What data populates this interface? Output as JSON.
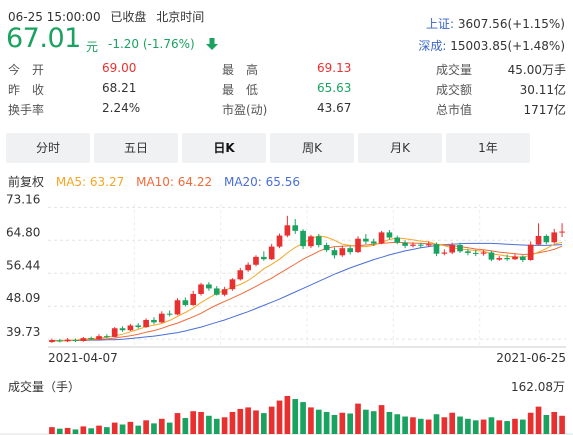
{
  "header": {
    "datetime": "06-25 15:00:00",
    "status": "已收盘",
    "timezone": "北京时间",
    "price": "67.01",
    "unit": "元",
    "change": "-1.20 (-1.76%)",
    "direction_icon": "arrow-down-icon",
    "down_color": "#1aa260",
    "up_color": "#e93030"
  },
  "indices": [
    {
      "label": "上证:",
      "value": "3607.56(+1.15%)"
    },
    {
      "label": "深成:",
      "value": "15003.85(+1.48%)"
    }
  ],
  "stats": {
    "open_label": "今　开",
    "open_value": "69.00",
    "high_label": "最　高",
    "high_value": "69.13",
    "volume_label": "成交量",
    "volume_value": "45.00万手",
    "prev_label": "昨　收",
    "prev_value": "68.21",
    "low_label": "最　低",
    "low_value": "65.63",
    "amount_label": "成交额",
    "amount_value": "30.11亿",
    "turnover_label": "换手率",
    "turnover_value": "2.24%",
    "pe_label": "市盈(动)",
    "pe_value": "43.67",
    "mktcap_label": "总市值",
    "mktcap_value": "1717亿"
  },
  "tabs": [
    {
      "label": "分时",
      "active": false
    },
    {
      "label": "五日",
      "active": false
    },
    {
      "label": "日K",
      "active": true
    },
    {
      "label": "周K",
      "active": false
    },
    {
      "label": "月K",
      "active": false
    },
    {
      "label": "1年",
      "active": false
    }
  ],
  "legend": {
    "adjust": "前复权",
    "ma5": "MA5: 63.27",
    "ma10": "MA10: 64.22",
    "ma20": "MA20: 65.56",
    "ma5_color": "#f5a623",
    "ma10_color": "#f06a3a",
    "ma20_color": "#4a6fd6"
  },
  "volume_label": "成交量（手）",
  "volume_max_label": "162.08万",
  "chart_data": [
    {
      "type": "candlestick",
      "y_tick_labels": [
        "73.16",
        "64.80",
        "56.44",
        "48.09",
        "39.73"
      ],
      "y_ticks": [
        73.16,
        64.8,
        56.44,
        48.09,
        39.73
      ],
      "ylim": [
        38.0,
        74.0
      ],
      "x_tick_labels": [
        "2021-04-07",
        "2021-06-25"
      ],
      "grid": true,
      "candles": [
        [
          39.0,
          39.5,
          39.9,
          38.8
        ],
        [
          39.4,
          39.2,
          39.8,
          38.9
        ],
        [
          39.2,
          39.6,
          40.0,
          39.0
        ],
        [
          39.5,
          39.3,
          39.9,
          39.0
        ],
        [
          39.3,
          40.0,
          40.3,
          39.1
        ],
        [
          40.0,
          39.7,
          40.4,
          39.4
        ],
        [
          39.7,
          40.5,
          41.0,
          39.6
        ],
        [
          40.5,
          40.3,
          41.0,
          40.0
        ],
        [
          40.3,
          42.5,
          42.8,
          40.2
        ],
        [
          42.5,
          42.0,
          43.0,
          41.6
        ],
        [
          42.0,
          43.2,
          43.6,
          41.8
        ],
        [
          43.2,
          42.8,
          43.8,
          42.4
        ],
        [
          42.8,
          44.6,
          45.0,
          42.6
        ],
        [
          44.6,
          44.0,
          45.3,
          43.5
        ],
        [
          44.0,
          46.2,
          46.8,
          43.8
        ],
        [
          46.2,
          46.0,
          47.0,
          45.5
        ],
        [
          46.0,
          49.6,
          50.1,
          45.8
        ],
        [
          49.6,
          48.4,
          50.3,
          48.0
        ],
        [
          48.4,
          51.2,
          52.0,
          48.2
        ],
        [
          51.2,
          53.6,
          54.0,
          50.8
        ],
        [
          53.6,
          52.6,
          54.2,
          52.0
        ],
        [
          52.6,
          51.0,
          53.2,
          50.8
        ],
        [
          51.0,
          52.4,
          53.0,
          50.6
        ],
        [
          52.4,
          54.9,
          55.2,
          52.0
        ],
        [
          54.9,
          57.2,
          57.8,
          54.6
        ],
        [
          57.2,
          58.6,
          59.2,
          56.8
        ],
        [
          58.6,
          60.6,
          61.0,
          58.2
        ],
        [
          60.6,
          60.0,
          62.0,
          59.6
        ],
        [
          60.0,
          63.2,
          63.9,
          59.8
        ],
        [
          63.2,
          66.0,
          66.5,
          62.8
        ],
        [
          66.0,
          68.6,
          71.0,
          65.6
        ],
        [
          68.6,
          67.2,
          70.2,
          66.4
        ],
        [
          67.2,
          63.3,
          67.6,
          62.6
        ],
        [
          63.3,
          65.8,
          66.2,
          62.8
        ],
        [
          65.8,
          63.6,
          66.4,
          63.0
        ],
        [
          63.6,
          62.3,
          64.2,
          61.8
        ],
        [
          62.3,
          61.0,
          63.0,
          60.2
        ],
        [
          61.0,
          62.8,
          63.4,
          60.6
        ],
        [
          62.8,
          61.8,
          63.4,
          61.2
        ],
        [
          61.8,
          65.2,
          65.8,
          61.6
        ],
        [
          65.2,
          64.5,
          66.4,
          63.8
        ],
        [
          64.5,
          64.0,
          65.2,
          63.4
        ],
        [
          64.0,
          66.8,
          67.2,
          63.8
        ],
        [
          66.8,
          65.5,
          67.4,
          65.0
        ],
        [
          65.5,
          64.2,
          66.0,
          63.8
        ],
        [
          64.2,
          63.4,
          64.8,
          62.8
        ],
        [
          63.4,
          63.7,
          64.3,
          63.0
        ],
        [
          63.7,
          63.5,
          64.2,
          62.9
        ],
        [
          63.5,
          63.8,
          64.5,
          63.1
        ],
        [
          63.8,
          61.4,
          64.2,
          60.8
        ],
        [
          61.4,
          61.7,
          62.5,
          61.0
        ],
        [
          61.7,
          63.6,
          64.2,
          61.3
        ],
        [
          63.6,
          62.0,
          64.2,
          61.6
        ],
        [
          62.0,
          61.6,
          62.6,
          61.0
        ],
        [
          61.6,
          61.4,
          62.4,
          60.8
        ],
        [
          61.4,
          61.7,
          62.3,
          60.9
        ],
        [
          61.7,
          59.9,
          62.2,
          59.5
        ],
        [
          59.9,
          60.3,
          60.8,
          59.6
        ],
        [
          60.3,
          60.0,
          61.2,
          59.6
        ],
        [
          60.0,
          60.7,
          61.4,
          59.8
        ],
        [
          60.7,
          59.8,
          61.0,
          59.3
        ],
        [
          59.8,
          63.7,
          64.5,
          59.6
        ],
        [
          63.7,
          65.9,
          69.1,
          63.5
        ],
        [
          65.9,
          64.3,
          66.3,
          63.8
        ],
        [
          64.3,
          66.8,
          67.7,
          64.0
        ],
        [
          66.8,
          67.01,
          69.13,
          65.63
        ]
      ],
      "ma5": [
        39.2,
        39.4,
        39.5,
        39.5,
        39.7,
        39.9,
        40.0,
        40.2,
        40.6,
        41.0,
        41.6,
        42.2,
        42.9,
        43.3,
        43.7,
        44.5,
        45.5,
        46.5,
        47.6,
        49.0,
        50.2,
        51.3,
        52.1,
        52.9,
        53.6,
        54.6,
        56.0,
        57.6,
        58.7,
        60.0,
        61.6,
        63.0,
        64.1,
        65.2,
        65.9,
        65.6,
        64.8,
        63.8,
        63.5,
        63.2,
        63.2,
        63.5,
        64.3,
        65.0,
        65.4,
        65.2,
        64.9,
        64.6,
        64.4,
        63.8,
        63.4,
        62.9,
        62.6,
        62.4,
        62.2,
        62.0,
        61.4,
        61.1,
        60.8,
        60.6,
        60.5,
        61.0,
        61.8,
        62.7,
        63.8,
        64.3
      ],
      "ma10": [
        39.3,
        39.3,
        39.4,
        39.4,
        39.5,
        39.6,
        39.7,
        39.8,
        40.0,
        40.3,
        40.6,
        41.0,
        41.5,
        41.9,
        42.5,
        43.2,
        43.8,
        44.6,
        45.4,
        46.3,
        47.4,
        48.4,
        49.3,
        50.2,
        51.1,
        52.1,
        53.1,
        54.2,
        55.2,
        56.4,
        57.6,
        58.8,
        60.0,
        61.0,
        62.0,
        62.8,
        63.2,
        63.3,
        63.4,
        63.4,
        63.6,
        63.8,
        64.0,
        64.2,
        64.3,
        64.2,
        64.1,
        64.0,
        63.9,
        63.8,
        63.6,
        63.4,
        63.2,
        62.9,
        62.6,
        62.4,
        62.1,
        61.8,
        61.6,
        61.4,
        61.2,
        61.3,
        61.6,
        62.0,
        62.5,
        63.3
      ],
      "ma20": [
        39.4,
        39.4,
        39.4,
        39.4,
        39.4,
        39.5,
        39.5,
        39.6,
        39.6,
        39.7,
        39.9,
        40.1,
        40.3,
        40.5,
        40.8,
        41.1,
        41.4,
        41.8,
        42.3,
        42.8,
        43.4,
        44.0,
        44.6,
        45.3,
        46.0,
        46.7,
        47.5,
        48.3,
        49.1,
        49.9,
        50.8,
        51.7,
        52.6,
        53.5,
        54.4,
        55.3,
        56.2,
        57.0,
        57.8,
        58.5,
        59.2,
        59.9,
        60.5,
        61.1,
        61.6,
        62.1,
        62.5,
        62.9,
        63.2,
        63.5,
        63.7,
        63.8,
        63.9,
        64.0,
        64.0,
        64.0,
        64.0,
        63.9,
        63.8,
        63.7,
        63.6,
        63.5,
        63.5,
        63.5,
        63.6,
        63.7
      ]
    },
    {
      "type": "bar",
      "title": "成交量（手）",
      "ymax_label": "162.08万",
      "values": [
        18,
        14,
        16,
        12,
        20,
        15,
        22,
        18,
        30,
        25,
        32,
        22,
        36,
        28,
        40,
        30,
        55,
        42,
        60,
        58,
        48,
        40,
        44,
        58,
        66,
        70,
        62,
        55,
        72,
        88,
        100,
        92,
        84,
        70,
        64,
        58,
        50,
        56,
        54,
        80,
        64,
        60,
        76,
        58,
        52,
        46,
        44,
        40,
        38,
        52,
        44,
        56,
        46,
        40,
        36,
        38,
        44,
        36,
        34,
        40,
        38,
        56,
        72,
        50,
        58,
        48
      ],
      "up_color": "#e93030",
      "down_color": "#1aa260"
    }
  ]
}
